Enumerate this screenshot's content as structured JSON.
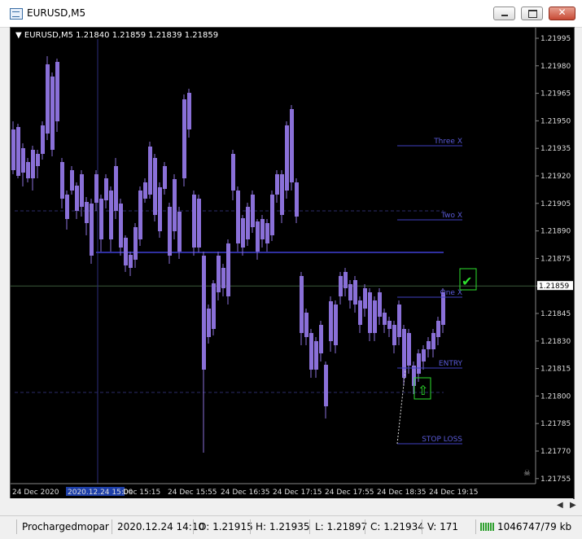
{
  "window": {
    "title": "EURUSD,M5",
    "close_glyph": "✕"
  },
  "chart": {
    "header": "▼ EURUSD,M5  1.21840 1.21859 1.21839 1.21859",
    "price_labels": [
      "1.21995",
      "1.21980",
      "1.21965",
      "1.21950",
      "1.21935",
      "1.21920",
      "1.21905",
      "1.21890",
      "1.21875",
      "1.21859",
      "1.21845",
      "1.21830",
      "1.21815",
      "1.21800",
      "1.21785",
      "1.21770",
      "1.21755"
    ],
    "current_price": "1.21859",
    "time_labels": [
      "24 Dec 2020",
      "2020.12.24 15:00",
      "Dec 15:15",
      "24 Dec 15:55",
      "24 Dec 16:35",
      "24 Dec 17:15",
      "24 Dec 17:55",
      "24 Dec 18:35",
      "24 Dec 19:15"
    ],
    "levels": [
      "Three X",
      "Two X",
      "One X",
      "ENTRY",
      "STOP LOSS"
    ],
    "colors": {
      "candle": "#8a70d8",
      "level": "#3f3fbf",
      "grid": "#2c2c4a",
      "accent": "#2ee02e"
    }
  },
  "status": {
    "profile": "Prochargedmopar",
    "datetime": "2020.12.24 14:10",
    "open": "O: 1.21915",
    "high": "H: 1.21935",
    "low": "L: 1.21897",
    "close": "C: 1.21934",
    "volume": "V: 171",
    "traffic": "1046747/79 kb"
  }
}
